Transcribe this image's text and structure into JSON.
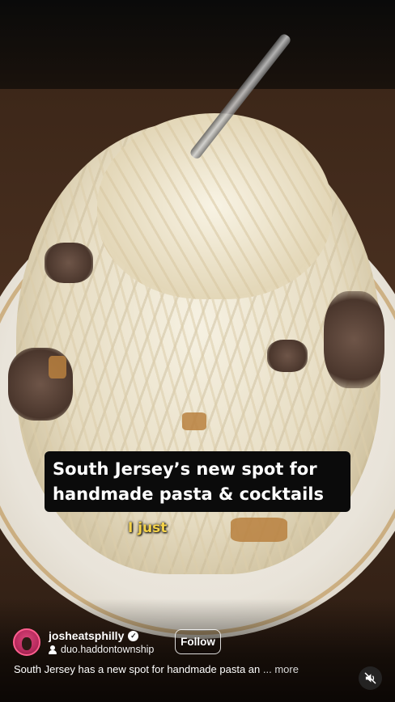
{
  "overlay": {
    "caption_line1": "South Jersey’s new spot for",
    "caption_line2": "handmade pasta & cocktails",
    "subtitle_word": "I just"
  },
  "author": {
    "username": "josheatsphilly",
    "verified": true,
    "collaborator": "duo.haddontownship"
  },
  "actions": {
    "follow_label": "Follow"
  },
  "post": {
    "description": "South Jersey has a new spot for handmade pasta an",
    "more_label": "... more"
  },
  "icons": {
    "verified": "verified-badge-icon",
    "collaborator": "person-icon",
    "mute": "speaker-muted-icon"
  },
  "colors": {
    "subtitle": "#f5d34a",
    "caption_bg": "#0b0b0b",
    "avatar_ring": "#ff5f8f"
  }
}
